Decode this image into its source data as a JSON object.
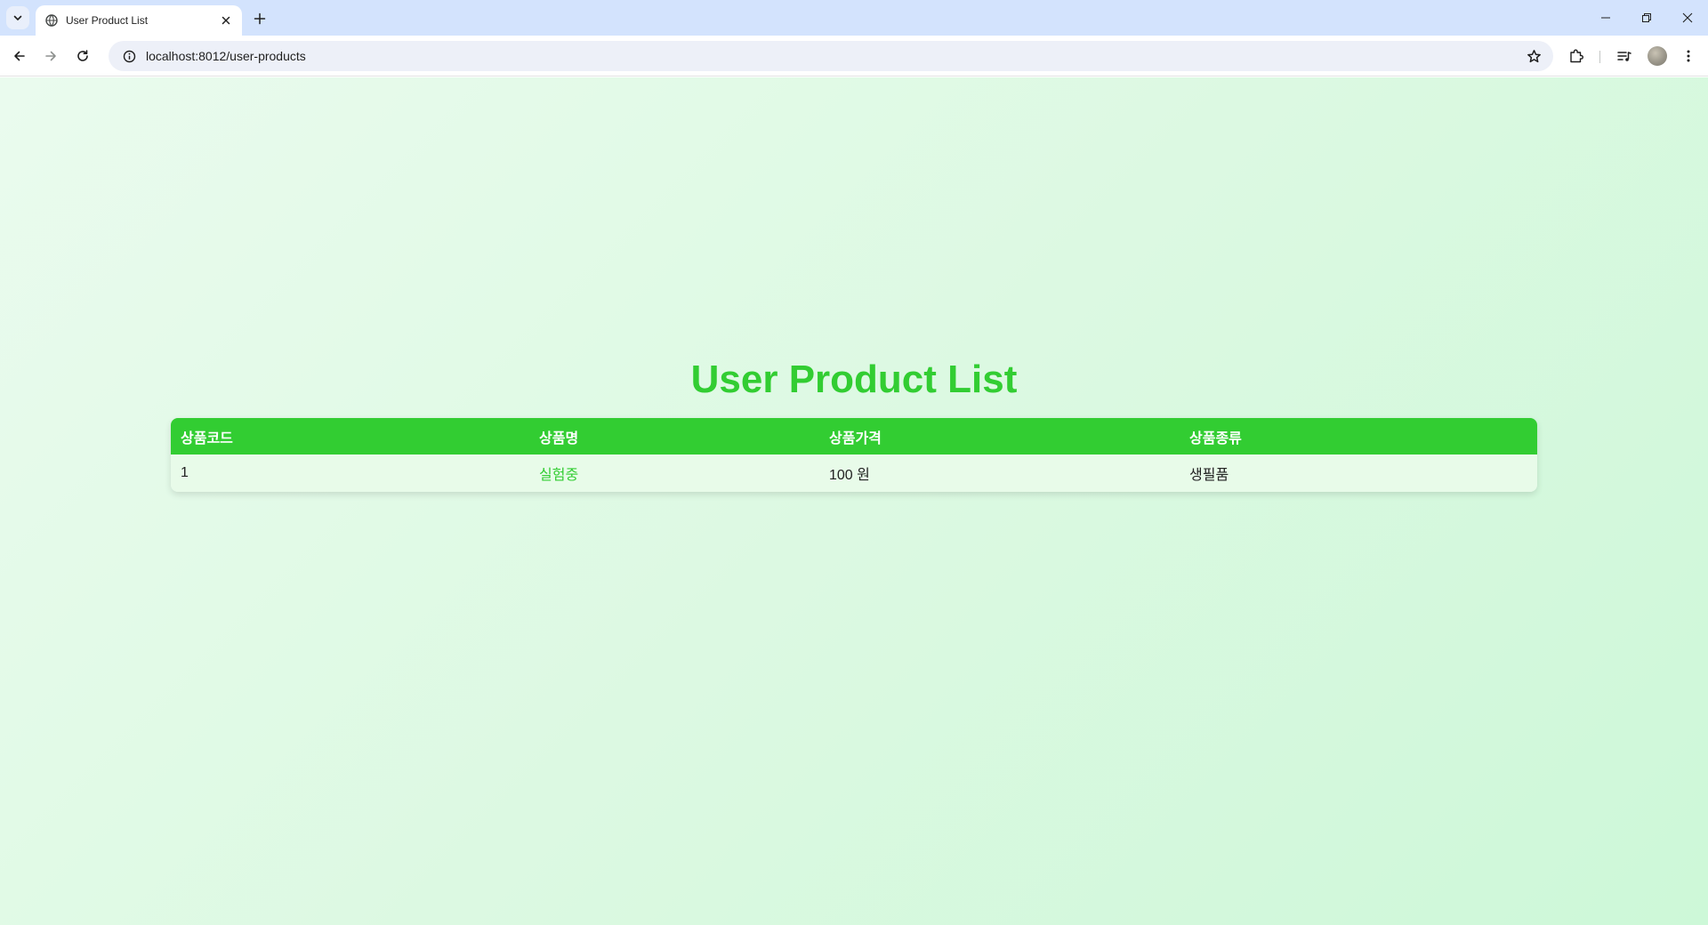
{
  "browser": {
    "tab_title": "User Product List",
    "url": "localhost:8012/user-products",
    "icons": {
      "tab_search": "chevron-down-icon",
      "favicon": "globe-icon",
      "tab_close": "close-icon",
      "new_tab": "plus-icon",
      "minimize": "minimize-icon",
      "restore": "restore-icon",
      "close_window": "close-icon",
      "back": "arrow-left-icon",
      "forward": "arrow-right-icon",
      "reload": "reload-icon",
      "site_info": "info-icon",
      "bookmark": "star-icon",
      "extensions": "puzzle-icon",
      "media": "media-queue-icon",
      "profile": "avatar",
      "menu": "more-vertical-icon"
    }
  },
  "page": {
    "title": "User Product List",
    "title_color": "#32cd32",
    "background": [
      "#eafbee",
      "#cdf8d8"
    ],
    "table": {
      "header_color": "#32cd32",
      "columns": [
        "상품코드",
        "상품명",
        "상품가격",
        "상품종류"
      ],
      "rows": [
        {
          "code": "1",
          "name": "실험중",
          "price": "100 원",
          "category": "생필품"
        }
      ]
    }
  }
}
